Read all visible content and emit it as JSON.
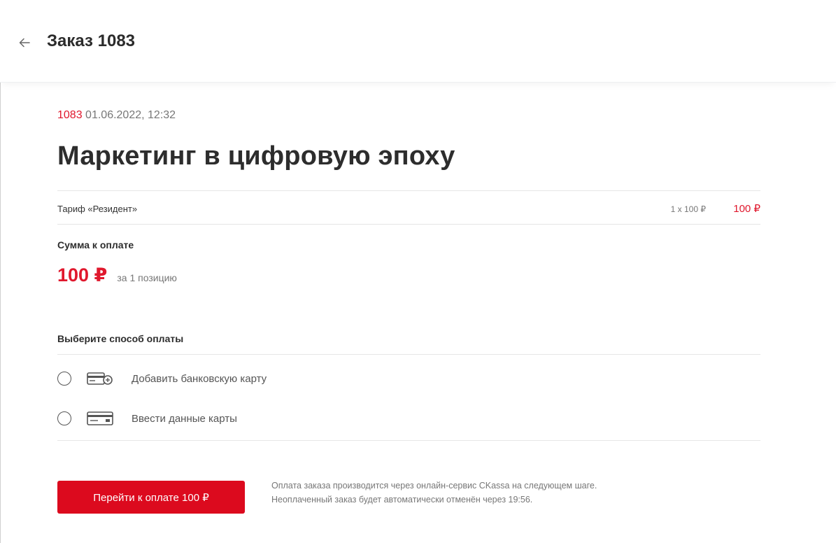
{
  "header": {
    "back_icon": "arrow-left-icon",
    "title": "Заказ 1083"
  },
  "order": {
    "number": "1083",
    "datetime": "01.06.2022, 12:32",
    "name": "Маркетинг в цифровую эпоху",
    "items": [
      {
        "name": "Тариф «Резидент»",
        "qty_price": "1 x 100 ₽",
        "total": "100 ₽"
      }
    ]
  },
  "summary": {
    "label": "Сумма к оплате",
    "amount": "100 ₽",
    "note": "за 1 позицию"
  },
  "payment": {
    "label": "Выберите способ оплаты",
    "options": [
      {
        "label": "Добавить банковскую карту",
        "icon": "card-add-icon",
        "selected": false
      },
      {
        "label": "Ввести данные карты",
        "icon": "card-icon",
        "selected": false
      }
    ],
    "button_label": "Перейти к оплате 100 ₽",
    "note_line1": "Оплата заказа производится через онлайн-сервис CKassa на следующем шаге.",
    "note_line2": "Неоплаченный заказ будет автоматически отменён через 19:56."
  },
  "colors": {
    "accent": "#e0182d",
    "button": "#dc0a1e",
    "muted_text": "#777777"
  }
}
